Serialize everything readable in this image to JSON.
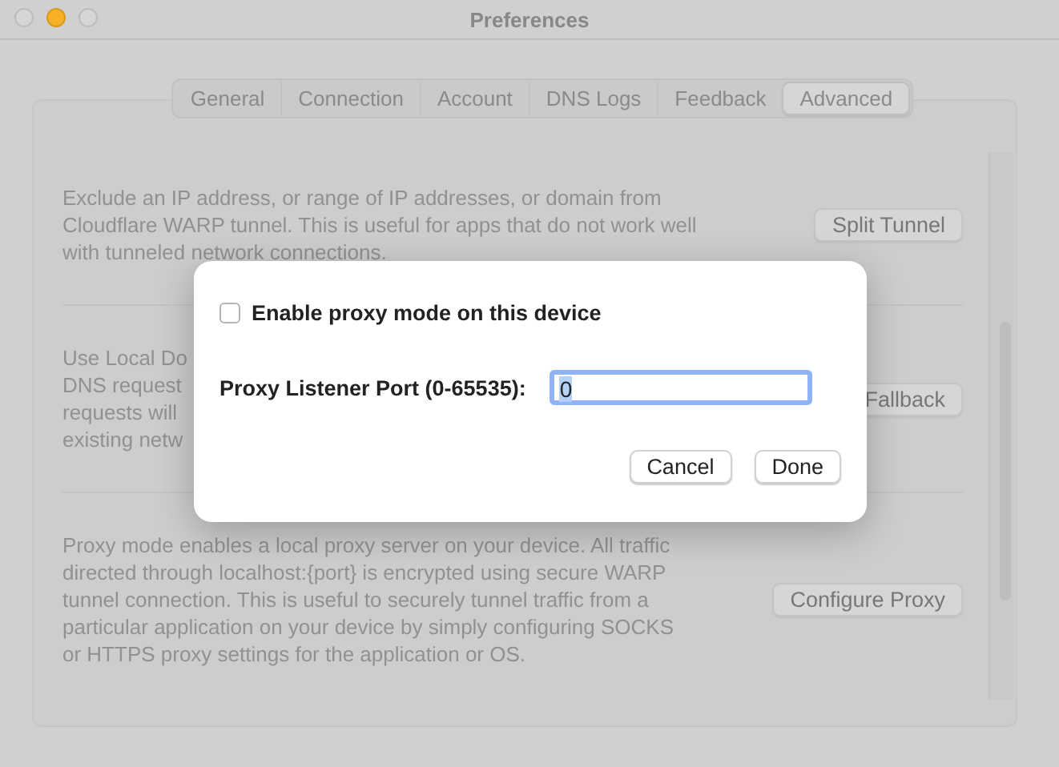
{
  "window": {
    "title": "Preferences"
  },
  "tabs": [
    {
      "label": "General",
      "selected": false
    },
    {
      "label": "Connection",
      "selected": false
    },
    {
      "label": "Account",
      "selected": false
    },
    {
      "label": "DNS Logs",
      "selected": false
    },
    {
      "label": "Feedback",
      "selected": false
    },
    {
      "label": "Advanced",
      "selected": true
    }
  ],
  "sections": [
    {
      "lines": [
        "Exclude an IP address, or range of IP addresses, or domain from",
        "Cloudflare WARP tunnel. This is useful for apps that do not work well",
        "with tunneled network connections."
      ],
      "button": "Split Tunnel"
    },
    {
      "lines": [
        "Use Local Do",
        "DNS request",
        "requests will",
        "existing netw"
      ],
      "button": "Fallback"
    },
    {
      "lines": [
        "Proxy mode enables a local proxy server on your device. All traffic",
        "directed through localhost:{port} is encrypted using secure WARP",
        "tunnel connection. This is useful to securely tunnel traffic from a",
        "particular application on your device by simply configuring SOCKS",
        "or HTTPS proxy settings for the application or OS."
      ],
      "button": "Configure Proxy"
    }
  ],
  "dialog": {
    "checkbox": {
      "label": "Enable proxy mode on this device",
      "checked": false
    },
    "port": {
      "label": "Proxy Listener Port (0-65535):",
      "value": "0"
    },
    "buttons": [
      "Cancel",
      "Done"
    ]
  }
}
